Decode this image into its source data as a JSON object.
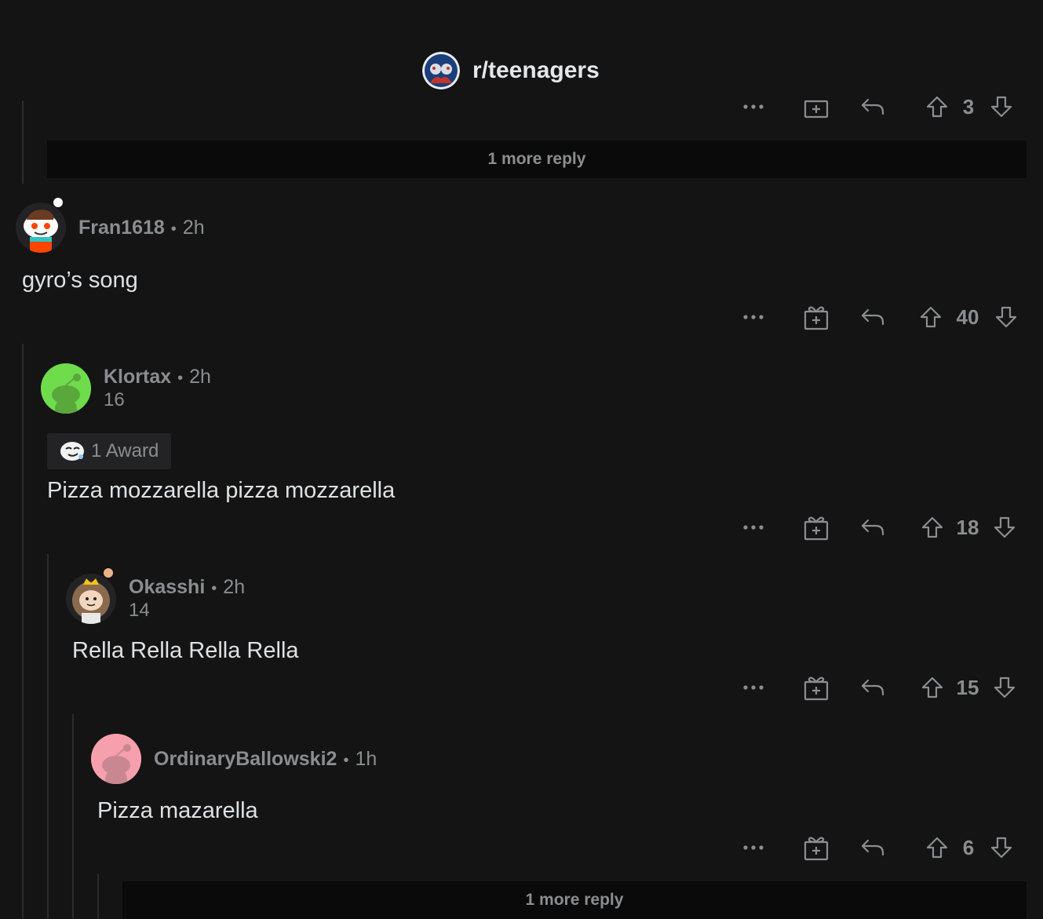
{
  "header": {
    "title": "r/teenagers",
    "icon": "subreddit-avatar-icon"
  },
  "more_reply_top": "1 more reply",
  "more_reply_bottom": "1 more reply",
  "top_actions": {
    "votes": "3"
  },
  "comments": [
    {
      "user": "Fran1618",
      "time": "2h",
      "flair": "",
      "body": "gyro’s song",
      "votes": "40"
    },
    {
      "user": "Klortax",
      "time": "2h",
      "flair": "16",
      "award": "1 Award",
      "body": "Pizza mozzarella pizza mozzarella",
      "votes": "18"
    },
    {
      "user": "Okasshi",
      "time": "2h",
      "flair": "14",
      "body": "Rella Rella Rella Rella",
      "votes": "15"
    },
    {
      "user": "OrdinaryBallowski2",
      "time": "1h",
      "flair": "",
      "body": "Pizza mazarella",
      "votes": "6"
    }
  ],
  "icons": [
    "more-options-icon",
    "award-gift-icon",
    "reply-icon",
    "upvote-icon",
    "downvote-icon"
  ],
  "colors": {
    "background": "#141415",
    "text": "#d7dadc",
    "muted": "#8b8d90",
    "avatar_green": "#6fdc4c",
    "avatar_pink": "#f7a0ad"
  }
}
